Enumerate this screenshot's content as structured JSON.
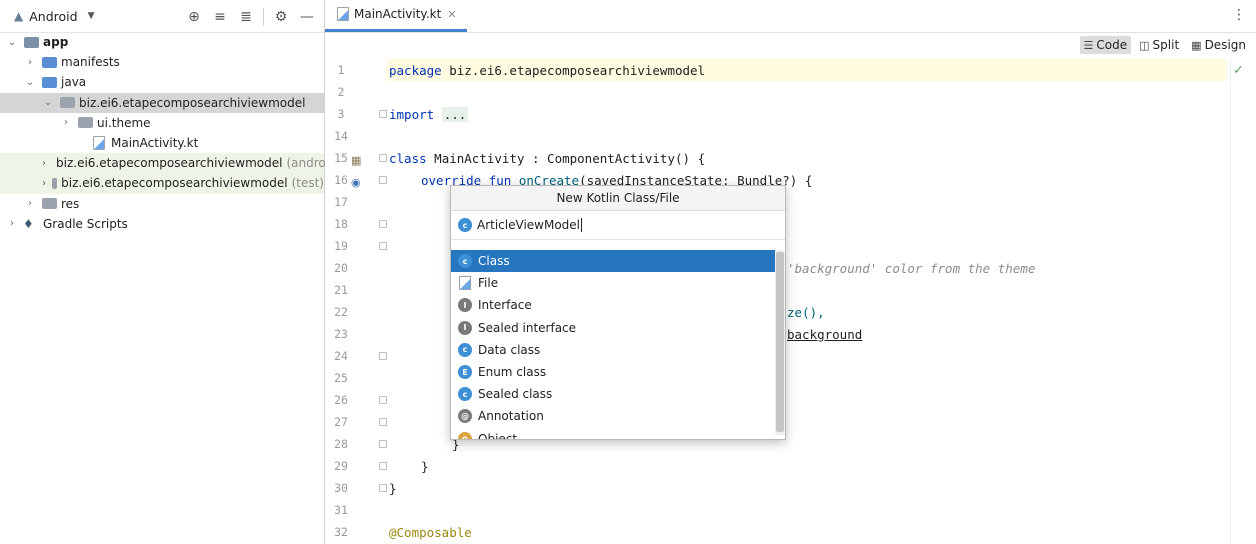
{
  "project": {
    "view_selector": "Android",
    "tree": [
      {
        "label": "app",
        "bold": true,
        "depth": 0,
        "expanded": true,
        "icon": "app-folder-icon"
      },
      {
        "label": "manifests",
        "depth": 1,
        "expanded": false,
        "icon": "folder-icon"
      },
      {
        "label": "java",
        "depth": 1,
        "expanded": true,
        "icon": "folder-icon"
      },
      {
        "label": "biz.ei6.etapecomposearchiviewmodel",
        "depth": 2,
        "expanded": true,
        "icon": "package-icon",
        "selected": true
      },
      {
        "label": "ui.theme",
        "depth": 3,
        "expanded": false,
        "icon": "package-icon"
      },
      {
        "label": "MainActivity.kt",
        "depth": 3,
        "icon": "kotlin-file-icon"
      },
      {
        "label": "biz.ei6.etapecomposearchiviewmodel",
        "suffix": "(androi",
        "depth": 2,
        "expanded": false,
        "icon": "package-icon",
        "highlight": true
      },
      {
        "label": "biz.ei6.etapecomposearchiviewmodel",
        "suffix": "(test)",
        "depth": 2,
        "expanded": false,
        "icon": "package-icon",
        "highlight": true
      },
      {
        "label": "res",
        "depth": 1,
        "expanded": false,
        "icon": "res-folder-icon"
      },
      {
        "label": "Gradle Scripts",
        "depth": 0,
        "expanded": false,
        "icon": "gradle-icon"
      }
    ]
  },
  "editor": {
    "tab_label": "MainActivity.kt",
    "view_modes": [
      "Code",
      "Split",
      "Design"
    ],
    "active_view_mode": "Code",
    "line_numbers": [
      "1",
      "2",
      "3",
      "14",
      "15",
      "16",
      "17",
      "18",
      "19",
      "20",
      "21",
      "22",
      "23",
      "24",
      "25",
      "26",
      "27",
      "28",
      "29",
      "30",
      "31",
      "32"
    ],
    "code": {
      "l1_kw": "package",
      "l1_rest": " biz.ei6.etapecomposearchiviewmodel",
      "l3_kw": "import",
      "l3_dots": "...",
      "l15_kw": "class",
      "l15_rest": " MainActivity : ComponentActivity() {",
      "l16_kw": "override fun",
      "l16_fn": "onCreate",
      "l16_rest": "(savedInstanceState: Bundle?) {",
      "l20_comment": "'background' color from the theme",
      "l22_frag": "ze(),",
      "l23_frag": "background",
      "l28_brace": "}",
      "l29_brace": "}",
      "l30_brace": "}",
      "l32_annotation": "@Composable"
    }
  },
  "popup": {
    "title": "New Kotlin Class/File",
    "input_value": "ArticleViewModel",
    "items": [
      {
        "label": "Class",
        "icon": "class-icon",
        "selected": true
      },
      {
        "label": "File",
        "icon": "kotlin-file-icon"
      },
      {
        "label": "Interface",
        "icon": "interface-icon"
      },
      {
        "label": "Sealed interface",
        "icon": "sealed-interface-icon"
      },
      {
        "label": "Data class",
        "icon": "data-class-icon"
      },
      {
        "label": "Enum class",
        "icon": "enum-class-icon"
      },
      {
        "label": "Sealed class",
        "icon": "sealed-class-icon"
      },
      {
        "label": "Annotation",
        "icon": "annotation-icon"
      },
      {
        "label": "Object",
        "icon": "object-icon"
      }
    ]
  },
  "colors": {
    "selection": "#2675bf",
    "keyword": "#0033b3",
    "comment": "#8c8c8c",
    "annotation": "#9e880d"
  }
}
